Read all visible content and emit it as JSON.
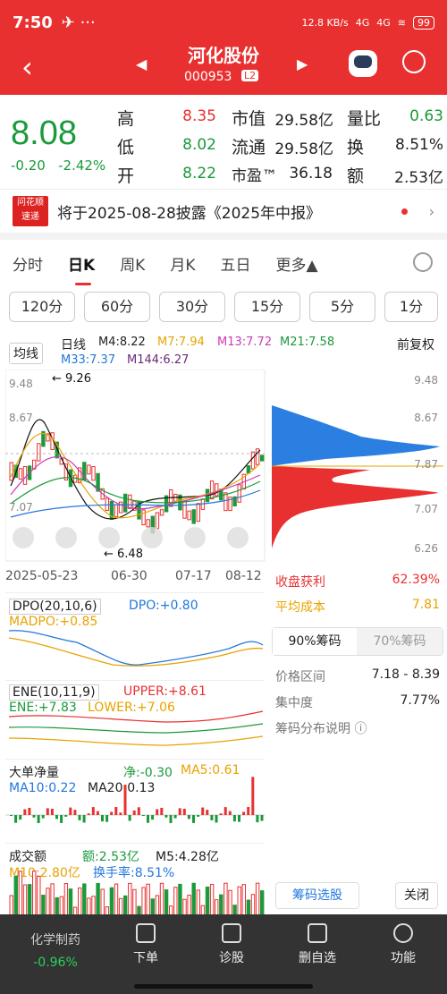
{
  "status_bar": {
    "time": "7:50",
    "net_speed": "12.8 KB/s",
    "signal1": "4G",
    "signal2": "4G",
    "battery": "99"
  },
  "header": {
    "stock_name": "河化股份",
    "stock_code": "000953",
    "level_tag": "L2"
  },
  "quote": {
    "price": "8.08",
    "change": "-0.20",
    "change_pct": "-2.42%",
    "high_label": "高",
    "high": "8.35",
    "low_label": "低",
    "low": "8.02",
    "open_label": "开",
    "open": "8.22",
    "mktcap_label": "市值",
    "mktcap": "29.58亿",
    "float_label": "流通",
    "float": "29.58亿",
    "pe_label": "市盈™",
    "pe": "36.18",
    "volratio_label": "量比",
    "volratio": "0.63",
    "turnover_label": "换",
    "turnover": "8.51%",
    "amount_label": "额",
    "amount": "2.53亿"
  },
  "news": {
    "badge_top": "问花顺",
    "badge_bottom": "速递",
    "text": "将于2025-08-28披露《2025年中报》"
  },
  "tabs": [
    "分时",
    "日K",
    "周K",
    "月K",
    "五日",
    "更多▲"
  ],
  "periods": [
    "120分",
    "60分",
    "30分",
    "15分",
    "5分",
    "1分"
  ],
  "kline": {
    "ma_selector": "均线",
    "type": "日线",
    "ma4": "M4:8.22",
    "ma7": "M7:7.94",
    "ma13": "M13:7.72",
    "ma21": "M21:7.58",
    "ma33": "M33:7.37",
    "ma144": "M144:6.27",
    "adjust": "前复权",
    "high_mark": "9.26",
    "low_mark": "6.48",
    "y_labels": [
      "9.48",
      "8.67",
      "7.07"
    ],
    "x_labels": [
      "2025-05-23",
      "06-30",
      "07-17",
      "08-12"
    ]
  },
  "chip": {
    "y_labels": [
      "9.48",
      "8.67",
      "7.87",
      "7.07",
      "6.26"
    ],
    "profit_label": "收盘获利",
    "profit": "62.39%",
    "avg_cost_label": "平均成本",
    "avg_cost": "7.81",
    "tab90": "90%筹码",
    "tab70": "70%筹码",
    "range_label": "价格区间",
    "range": "7.18 - 8.39",
    "concentration_label": "集中度",
    "concentration": "7.77%",
    "explain": "筹码分布说明 ⓘ",
    "select_button": "筹码选股",
    "close_button": "关闭"
  },
  "dpo": {
    "name": "DPO(20,10,6)",
    "dpo": "DPO:+0.80",
    "madpo": "MADPO:+0.85"
  },
  "ene": {
    "name": "ENE(10,11,9)",
    "upper": "UPPER:+8.61",
    "ene": "ENE:+7.83",
    "lower": "LOWER:+7.06"
  },
  "bigorder": {
    "name": "大单净量",
    "net": "净:-0.30",
    "ma5": "MA5:0.61",
    "ma10": "MA10:0.22",
    "ma20": "MA20:0.13"
  },
  "volume": {
    "name": "成交额",
    "amount": "额:2.53亿",
    "m5": "M5:4.28亿",
    "m10": "M10:2.80亿",
    "turnover": "换手率:8.51%"
  },
  "bottom_nav": {
    "sector": "化学制药",
    "sector_change": "-0.96%",
    "items": [
      "下单",
      "诊股",
      "删自选",
      "功能"
    ]
  },
  "colors": {
    "red": "#e93030",
    "green": "#1a9a3a",
    "blue": "#2277dd",
    "orange": "#e8a300",
    "magenta": "#c83db5"
  }
}
